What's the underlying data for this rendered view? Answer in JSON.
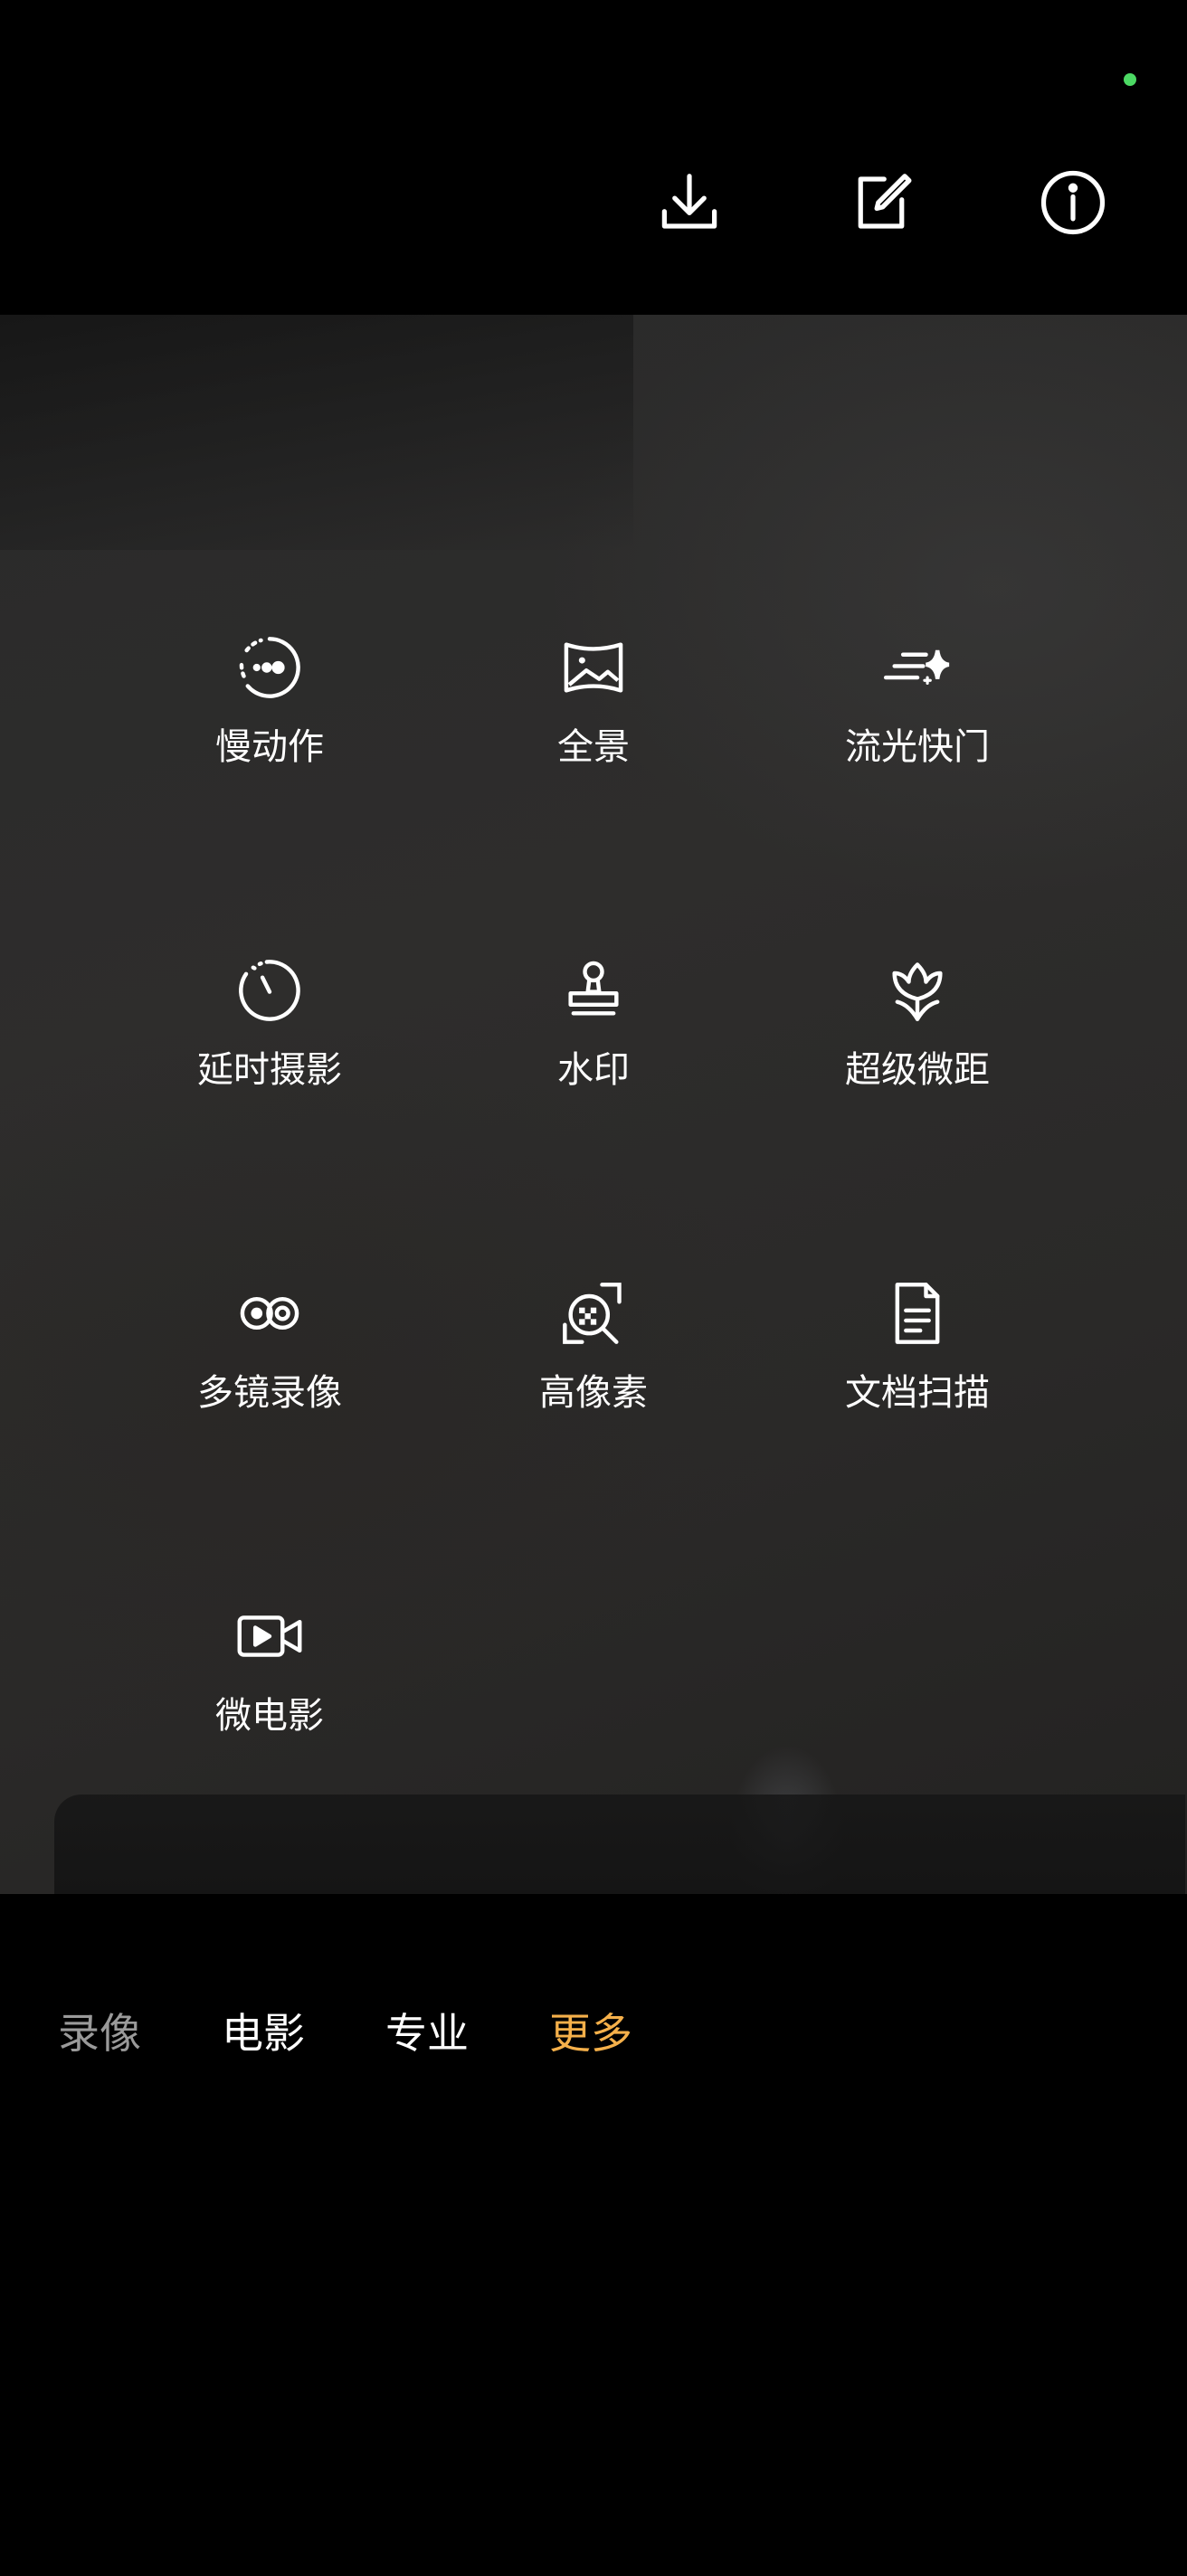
{
  "status": {
    "indicator_color": "#4cd964"
  },
  "toolbar": {
    "icons": [
      {
        "name": "download-icon"
      },
      {
        "name": "edit-icon"
      },
      {
        "name": "info-icon"
      }
    ]
  },
  "modes": [
    {
      "label": "慢动作",
      "icon": "slow-motion-icon"
    },
    {
      "label": "全景",
      "icon": "panorama-icon"
    },
    {
      "label": "流光快门",
      "icon": "light-shutter-icon"
    },
    {
      "label": "延时摄影",
      "icon": "timelapse-icon"
    },
    {
      "label": "水印",
      "icon": "watermark-stamp-icon"
    },
    {
      "label": "超级微距",
      "icon": "macro-flower-icon"
    },
    {
      "label": "多镜录像",
      "icon": "multi-lens-icon"
    },
    {
      "label": "高像素",
      "icon": "high-pixel-icon"
    },
    {
      "label": "文档扫描",
      "icon": "document-icon"
    },
    {
      "label": "微电影",
      "icon": "micro-movie-icon"
    }
  ],
  "tabs": [
    {
      "label": "录像",
      "color": "#9a9a9a"
    },
    {
      "label": "电影",
      "color": "#ffffff"
    },
    {
      "label": "专业",
      "color": "#ffffff"
    },
    {
      "label": "更多",
      "color": "#f5b04a",
      "selected": true
    }
  ]
}
